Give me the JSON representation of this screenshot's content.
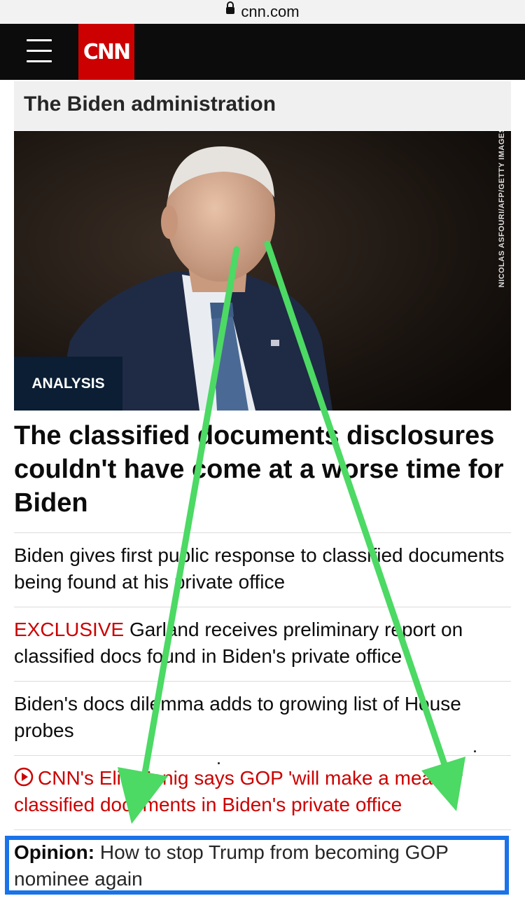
{
  "browser": {
    "url": "cnn.com"
  },
  "header": {
    "logo": "CNN"
  },
  "section": {
    "title": "The Biden administration"
  },
  "hero": {
    "credit": "NICOLAS ASFOURI/AFP/GETTY IMAGES",
    "badge": "ANALYSIS"
  },
  "headline": "The classified documents disclosures couldn't have come at a worse time for Biden",
  "related": [
    {
      "text": "Biden gives first public response to classified documents being found at his private office"
    },
    {
      "prefix": "EXCLUSIVE",
      "text": "Garland receives preliminary report on classified docs found in Biden's private office"
    },
    {
      "text": "Biden's docs dilemma adds to growing list of House probes"
    },
    {
      "text": "CNN's Elie Honig says GOP 'will make a meal' of classified documents in Biden's private office"
    },
    {
      "prefix": "Opinion:",
      "text": "How to stop Trump from becoming GOP nominee again"
    }
  ],
  "annotation": {
    "arrow_color": "#4cd964",
    "box_color": "#1a73e8"
  }
}
